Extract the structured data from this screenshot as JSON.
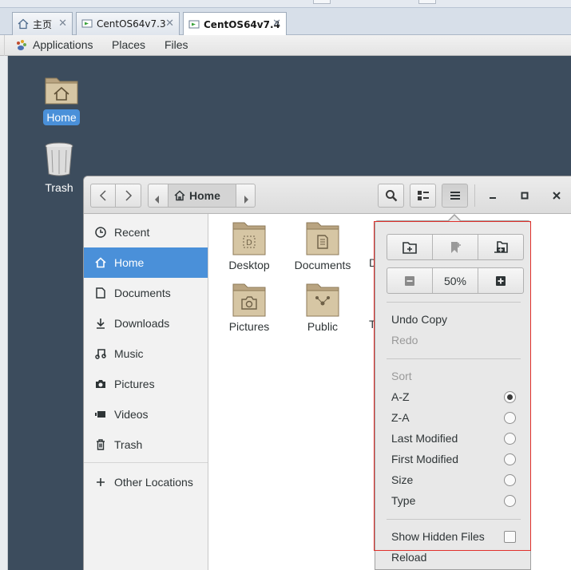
{
  "vmware": {
    "tabs": [
      {
        "label": "主页",
        "active": false
      },
      {
        "label": "CentOS64v7.3",
        "active": false
      },
      {
        "label": "CentOS64v7.4",
        "active": true
      }
    ],
    "close_glyph": "✕"
  },
  "topbar": {
    "applications": "Applications",
    "places": "Places",
    "files": "Files"
  },
  "desktop": {
    "icons": [
      {
        "label": "Home",
        "selected": true,
        "icon": "home-folder-icon"
      },
      {
        "label": "Trash",
        "selected": false,
        "icon": "trash-can-icon"
      }
    ]
  },
  "window": {
    "path": "Home",
    "sidebar": [
      {
        "label": "Recent",
        "icon": "clock-icon",
        "active": false
      },
      {
        "label": "Home",
        "icon": "home-icon",
        "active": true
      },
      {
        "label": "Documents",
        "icon": "document-icon",
        "active": false
      },
      {
        "label": "Downloads",
        "icon": "download-icon",
        "active": false
      },
      {
        "label": "Music",
        "icon": "music-icon",
        "active": false
      },
      {
        "label": "Pictures",
        "icon": "camera-icon",
        "active": false
      },
      {
        "label": "Videos",
        "icon": "video-icon",
        "active": false
      },
      {
        "label": "Trash",
        "icon": "trash-icon",
        "active": false
      },
      {
        "label": "Other Locations",
        "icon": "plus-icon",
        "active": false
      }
    ],
    "files": [
      {
        "label": "Desktop",
        "icon": "desktop-folder-icon"
      },
      {
        "label": "Documents",
        "icon": "documents-folder-icon"
      },
      {
        "label": "D",
        "icon": "folder-icon"
      },
      {
        "label": "Pictures",
        "icon": "pictures-folder-icon"
      },
      {
        "label": "Public",
        "icon": "public-folder-icon"
      },
      {
        "label": "T",
        "icon": "folder-icon"
      }
    ]
  },
  "menu": {
    "zoom": "50%",
    "undo": "Undo Copy",
    "redo": "Redo",
    "sort_header": "Sort",
    "sort_options": [
      {
        "label": "A-Z",
        "checked": true
      },
      {
        "label": "Z-A",
        "checked": false
      },
      {
        "label": "Last Modified",
        "checked": false
      },
      {
        "label": "First Modified",
        "checked": false
      },
      {
        "label": "Size",
        "checked": false
      },
      {
        "label": "Type",
        "checked": false
      }
    ],
    "show_hidden": "Show Hidden Files",
    "show_hidden_checked": false,
    "reload": "Reload"
  }
}
